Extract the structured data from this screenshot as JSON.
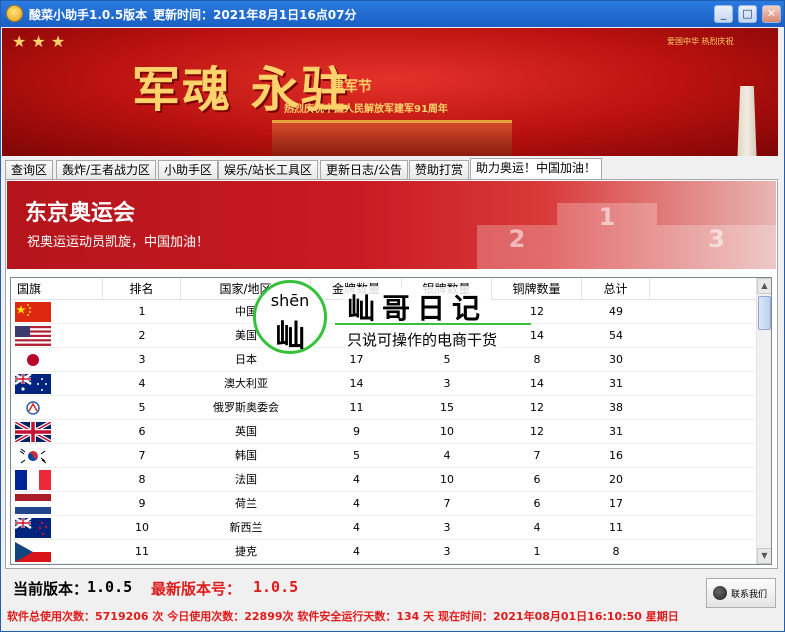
{
  "window": {
    "title": "酸菜小助手1.0.5版本",
    "update_time_text": "更新时间：2021年8月1日16点07分",
    "btn_min": "_",
    "btn_max": "□",
    "btn_close": "✕"
  },
  "top_banner": {
    "main_text": "军魂 永驻",
    "army_day": "建军节",
    "subtitle": "热烈庆祝中国人民解放军建军91周年",
    "corner_text": "爱国中华 热烈庆祝"
  },
  "tabs": [
    {
      "label": "查询区",
      "active": false
    },
    {
      "label": "轰炸/王者战力区",
      "active": false
    },
    {
      "label": "小助手区",
      "active": false
    },
    {
      "label": "娱乐/站长工具区",
      "active": false
    },
    {
      "label": "更新日志/公告",
      "active": false
    },
    {
      "label": "赞助打赏",
      "active": false
    },
    {
      "label": "助力奥运！中国加油！",
      "active": true
    }
  ],
  "olympic_banner": {
    "title": "东京奥运会",
    "subtitle": "祝奥运运动员凯旋，中国加油！",
    "podium": [
      "1",
      "2",
      "3"
    ]
  },
  "table": {
    "columns": [
      "国旗",
      "排名",
      "国家/地区",
      "金牌数量",
      "银牌数量",
      "铜牌数量",
      "总计"
    ],
    "rows": [
      {
        "flag": "china-flag-icon",
        "rank": "1",
        "country": "中国",
        "gold": "2",
        "silver": "",
        "bronze": "12",
        "total": "49"
      },
      {
        "flag": "usa-flag-icon",
        "rank": "2",
        "country": "美国",
        "gold": "",
        "silver": "",
        "bronze": "14",
        "total": "54"
      },
      {
        "flag": "japan-flag-icon",
        "rank": "3",
        "country": "日本",
        "gold": "17",
        "silver": "5",
        "bronze": "8",
        "total": "30"
      },
      {
        "flag": "australia-flag-icon",
        "rank": "4",
        "country": "澳大利亚",
        "gold": "14",
        "silver": "3",
        "bronze": "14",
        "total": "31"
      },
      {
        "flag": "roc-flag-icon",
        "rank": "5",
        "country": "俄罗斯奥委会",
        "gold": "11",
        "silver": "15",
        "bronze": "12",
        "total": "38"
      },
      {
        "flag": "uk-flag-icon",
        "rank": "6",
        "country": "英国",
        "gold": "9",
        "silver": "10",
        "bronze": "12",
        "total": "31"
      },
      {
        "flag": "korea-flag-icon",
        "rank": "7",
        "country": "韩国",
        "gold": "5",
        "silver": "4",
        "bronze": "7",
        "total": "16"
      },
      {
        "flag": "france-flag-icon",
        "rank": "8",
        "country": "法国",
        "gold": "4",
        "silver": "10",
        "bronze": "6",
        "total": "20"
      },
      {
        "flag": "netherlands-flag-icon",
        "rank": "9",
        "country": "荷兰",
        "gold": "4",
        "silver": "7",
        "bronze": "6",
        "total": "17"
      },
      {
        "flag": "new-zealand-flag-icon",
        "rank": "10",
        "country": "新西兰",
        "gold": "4",
        "silver": "3",
        "bronze": "4",
        "total": "11"
      },
      {
        "flag": "czech-flag-icon",
        "rank": "11",
        "country": "捷克",
        "gold": "4",
        "silver": "3",
        "bronze": "1",
        "total": "8"
      }
    ]
  },
  "watermark": {
    "pinyin": "shēn",
    "char": "屾",
    "title": "屾哥日记",
    "subtitle": "只说可操作的电商干货"
  },
  "footer": {
    "current_version_label": "当前版本：",
    "current_version": "1.0.5",
    "latest_version_label": "最新版本号：",
    "latest_version": "1.0.5",
    "contact_label": "联系我们",
    "status_text": "软件总使用次数：5719206 次  今日使用次数：22899次  软件安全运行天数：134 天  现在时间：2021年08月01日16:10:50   星期日"
  },
  "colors": {
    "title_bar": "#1a5fc4",
    "banner_red": "#b8110f",
    "accent_red": "#e01b1b",
    "watermark_green": "#35c23a"
  }
}
